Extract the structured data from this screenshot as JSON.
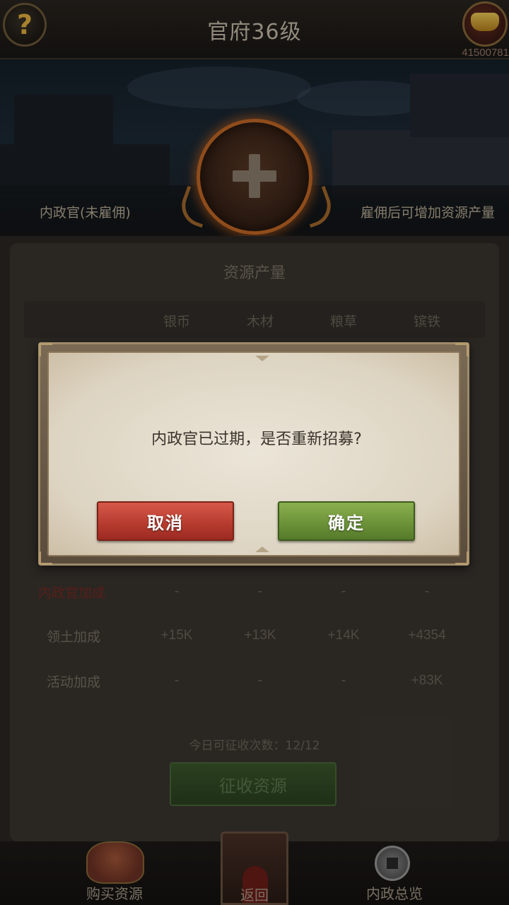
{
  "header": {
    "title": "官府36级",
    "help_icon_glyph": "?",
    "gold_amount": "41500781"
  },
  "banner": {
    "left_text": "内政官(未雇佣)",
    "right_text": "雇佣后可增加资源产量"
  },
  "resources": {
    "section_title": "资源产量",
    "columns": [
      "银币",
      "木材",
      "粮草",
      "镔铁"
    ],
    "rows": [
      {
        "label": "内政官加成",
        "values": [
          "-",
          "-",
          "-",
          "-"
        ]
      },
      {
        "label": "领土加成",
        "values": [
          "+15K",
          "+13K",
          "+14K",
          "+4354"
        ]
      },
      {
        "label": "活动加成",
        "values": [
          "-",
          "-",
          "-",
          "+83K"
        ]
      }
    ],
    "collect_count_label": "今日可征收次数：12/12",
    "collect_button": "征收资源"
  },
  "bottom_nav": {
    "buy": "购买资源",
    "back": "返回",
    "overview": "内政总览"
  },
  "dialog": {
    "message": "内政官已过期，是否重新招募?",
    "cancel": "取消",
    "confirm": "确定"
  },
  "colors": {
    "cancel_red": "#c0453a",
    "confirm_green": "#78a040",
    "hire_ring": "#c76a26"
  }
}
